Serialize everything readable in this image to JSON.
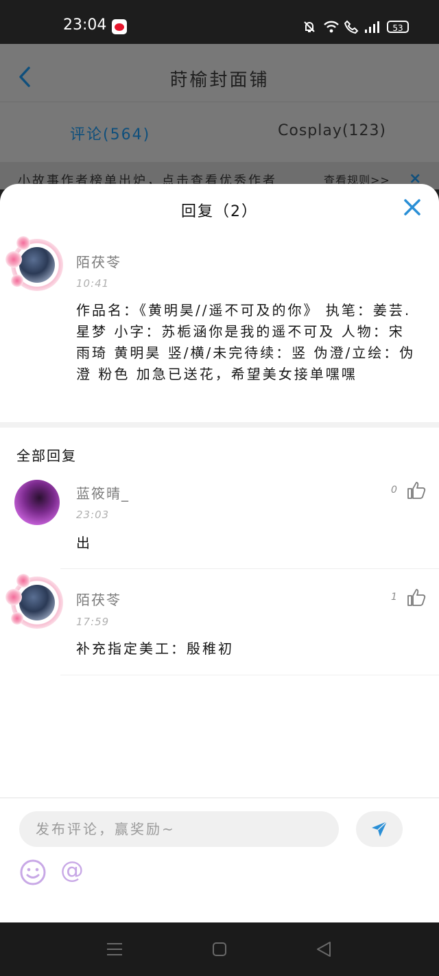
{
  "status_bar": {
    "time": "23:04",
    "battery": "53"
  },
  "background_page": {
    "title": "莳榆封面铺",
    "tabs": [
      {
        "label": "评论(564)",
        "active": true
      },
      {
        "label": "Cosplay(123)",
        "active": false
      }
    ],
    "notice": "小故事作者榜单出炉，点击查看优秀作者",
    "notice_link": "查看规则>>",
    "notice_close": "×"
  },
  "sheet": {
    "title": "回复（2）",
    "original_comment": {
      "author": "陌茯苓",
      "time": "10:41",
      "text": "作品名：《黄明昊//遥不可及的你》 执笔：姜芸.星梦 小字：苏栀涵你是我的遥不可及 人物：宋雨琦 黄明昊 竖/横/未完待续：竖 伪澄/立绘：伪澄 粉色 加急已送花，希望美女接单嘿嘿"
    },
    "all_replies_label": "全部回复",
    "replies": [
      {
        "author": "蓝筱晴_",
        "time": "23:03",
        "text": "出",
        "likes": "0"
      },
      {
        "author": "陌茯苓",
        "time": "17:59",
        "text": "补充指定美工：殷稚初",
        "likes": "1"
      }
    ]
  },
  "composer": {
    "placeholder": "发布评论，赢奖励~",
    "at_symbol": "@"
  },
  "colors": {
    "accent": "#2a8fd6",
    "overlay": "#787878"
  }
}
